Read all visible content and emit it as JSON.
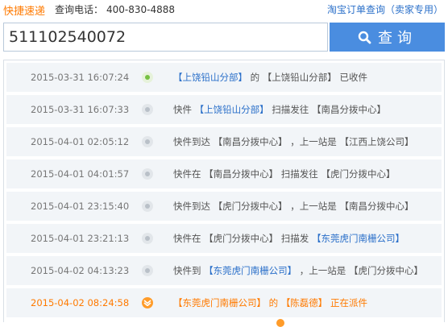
{
  "header": {
    "brand": "快捷速递",
    "hotline_label": "查询电话：",
    "hotline_value": "400-830-4888",
    "top_link": "淘宝订单查询（卖家专用）"
  },
  "search": {
    "value": "511102540072",
    "button_label": "查询"
  },
  "colors": {
    "accent": "#ff7a00",
    "link": "#2a6fc9",
    "button": "#4a8de0",
    "row_bg": "#f2f5f8",
    "dot_first": "#76c043"
  },
  "tracking": [
    {
      "time": "2015-03-31 16:07:24",
      "parts": [
        {
          "t": "【上饶铅山分部】",
          "link": true
        },
        {
          "t": " 的 【上饶铅山分部】 已收件",
          "link": false
        }
      ]
    },
    {
      "time": "2015-03-31 16:07:33",
      "parts": [
        {
          "t": "快件 ",
          "link": false
        },
        {
          "t": "【上饶铅山分部】",
          "link": true
        },
        {
          "t": " 扫描发往 【南昌分拨中心】",
          "link": false
        }
      ]
    },
    {
      "time": "2015-04-01 02:05:12",
      "parts": [
        {
          "t": "快件到达 【南昌分拨中心】 ，上一站是 【江西上饶公司】",
          "link": false
        }
      ]
    },
    {
      "time": "2015-04-01 04:01:57",
      "parts": [
        {
          "t": "快件在 【南昌分拨中心】 扫描发往 【虎门分拨中心】",
          "link": false
        }
      ]
    },
    {
      "time": "2015-04-01 23:15:40",
      "parts": [
        {
          "t": "快件到达 【虎门分拨中心】 ，上一站是 【南昌分拨中心】",
          "link": false
        }
      ]
    },
    {
      "time": "2015-04-01 23:21:13",
      "parts": [
        {
          "t": "快件在 【虎门分拨中心】 扫描发 ",
          "link": false
        },
        {
          "t": "【东莞虎门南栅公司】",
          "link": true
        }
      ]
    },
    {
      "time": "2015-04-02 04:13:23",
      "parts": [
        {
          "t": "快件到 ",
          "link": false
        },
        {
          "t": "【东莞虎门南栅公司】",
          "link": true
        },
        {
          "t": " ，上一站是 【虎门分拨中心】",
          "link": false
        }
      ]
    },
    {
      "time": "2015-04-02 08:24:58",
      "current": true,
      "parts": [
        {
          "t": "【东莞虎门南栅公司】",
          "link": true
        },
        {
          "t": " 的 ",
          "link": false
        },
        {
          "t": "【陈磊德】",
          "link": true
        },
        {
          "t": " 正在派件",
          "link": false
        }
      ]
    }
  ]
}
